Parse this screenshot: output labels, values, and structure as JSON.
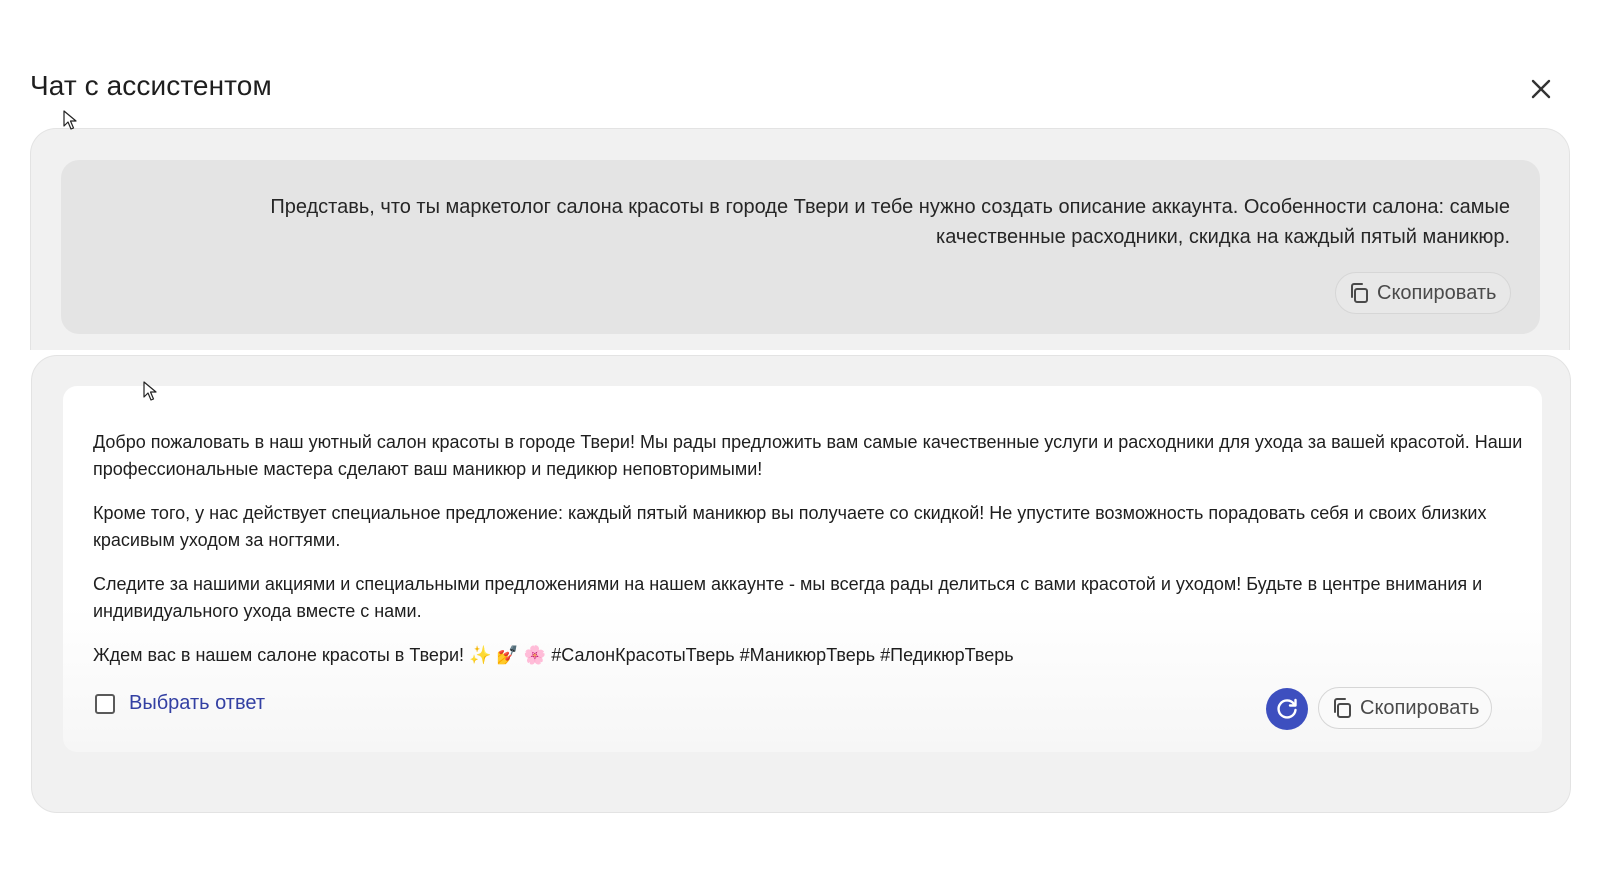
{
  "dialog": {
    "title": "Чат с ассистентом"
  },
  "prompt": {
    "text": "Представь, что ты маркетолог салона красоты в городе Твери и тебе нужно создать описание аккаунта. Особенности салона: самые качественные расходники, скидка на каждый пятый маникюр.",
    "copy_label": "Скопировать"
  },
  "answer": {
    "paragraphs": [
      "Добро пожаловать в наш уютный салон красоты в городе Твери! Мы рады предложить вам самые качественные услуги и расходники для ухода за вашей красотой. Наши профессиональные мастера сделают ваш маникюр и педикюр неповторимыми!",
      "Кроме того, у нас действует специальное предложение: каждый пятый маникюр вы получаете со скидкой! Не упустите возможность порадовать себя и своих близких красивым уходом за ногтями.",
      "Следите за нашими акциями и специальными предложениями на нашем аккаунте - мы всегда рады делиться с вами красотой и уходом! Будьте в центре внимания и индивидуального ухода вместе с нами.",
      "Ждем вас в нашем салоне красоты в Твери! ✨ 💅 🌸 #СалонКрасотыТверь #МаникюрТверь #ПедикюрТверь"
    ],
    "select_label": "Выбрать ответ",
    "copy_label": "Скопировать"
  },
  "icons": {
    "close": "close-icon",
    "copy": "copy-icon",
    "regenerate": "refresh-icon",
    "checkbox": "checkbox-unchecked"
  },
  "colors": {
    "accent": "#3d4fbf",
    "link": "#3340a3",
    "panel": "#f1f1f1",
    "prompt_card": "#e4e4e4"
  }
}
